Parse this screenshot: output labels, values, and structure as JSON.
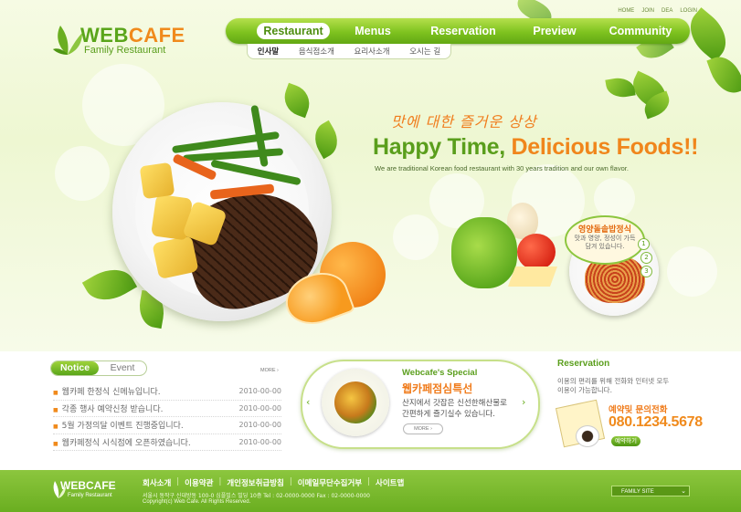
{
  "brand": {
    "name_part1": "WEB",
    "name_part2": "CAFE",
    "sub": "Family Restaurant",
    "green": "#5aa51a",
    "orange": "#f08a1c"
  },
  "utility": [
    "HOME",
    "JOIN",
    "DEA",
    "LOGIN"
  ],
  "nav": {
    "items": [
      "Restaurant",
      "Menus",
      "Reservation",
      "Preview",
      "Community"
    ],
    "active": "Restaurant"
  },
  "subnav": {
    "items": [
      "인사말",
      "음식점소개",
      "요리사소개",
      "오시는 길"
    ]
  },
  "hero": {
    "kor_script": "맛에 대한 즐거운 상상",
    "headline_green": "Happy Time, ",
    "headline_orange": "Delicious Foods!!",
    "tagline": "We are traditional Korean food restaurant with  30 years tradition and our own flavor.",
    "badge_title": "영양돌솥밥정식",
    "badge_text1": "맛과 영양, 정성이 가득",
    "badge_text2": "담겨 있습니다.",
    "badge_numbers": [
      "1",
      "2",
      "3"
    ]
  },
  "notice": {
    "tabs": [
      "Notice",
      "Event"
    ],
    "more": "MORE ›",
    "items": [
      {
        "text": "웹카페 한정식 신메뉴입니다.",
        "date": "2010-00-00"
      },
      {
        "text": "각종 행사 예약신청 받습니다.",
        "date": "2010-00-00"
      },
      {
        "text": "5월 가정의달 이벤트 진행중입니다.",
        "date": "2010-00-00"
      },
      {
        "text": "웹카페정식 시식점에 오픈하였습니다.",
        "date": "2010-00-00"
      }
    ]
  },
  "special": {
    "title": "Webcafe's Special",
    "kor_title": "웹카페점심특선",
    "desc1": "산지에서 갓잡은 신선한해산물로",
    "desc2": "간편하게 즐기실수 있습니다.",
    "more": "MORE ›",
    "prev": "‹",
    "next": "›"
  },
  "reservation": {
    "title": "Reservation",
    "desc1": "이용의 편리를 위해 전화와 인터넷 모두",
    "desc2": "이용이 가능합니다.",
    "label": "예약및 문의전화",
    "phone": "080.1234.5678",
    "button": "예약하기"
  },
  "footer": {
    "logo": "WEBCAFE",
    "logo_sub": "Family Restaurant",
    "links": [
      "회사소개",
      "이용약관",
      "개인정보취급방침",
      "이메일무단수집거부",
      "사이트맵"
    ],
    "address": "서울시 동작구 신대방동 100-0 심플빌스 빌딩 10층    Tel : 02-0000-0000   Fax : 02-0000-0000",
    "copyright": "Copyright(c)  Web Cafe.  All Rights Reserved.",
    "family_site": "FAMILY SITE",
    "chevron": "⌄"
  }
}
